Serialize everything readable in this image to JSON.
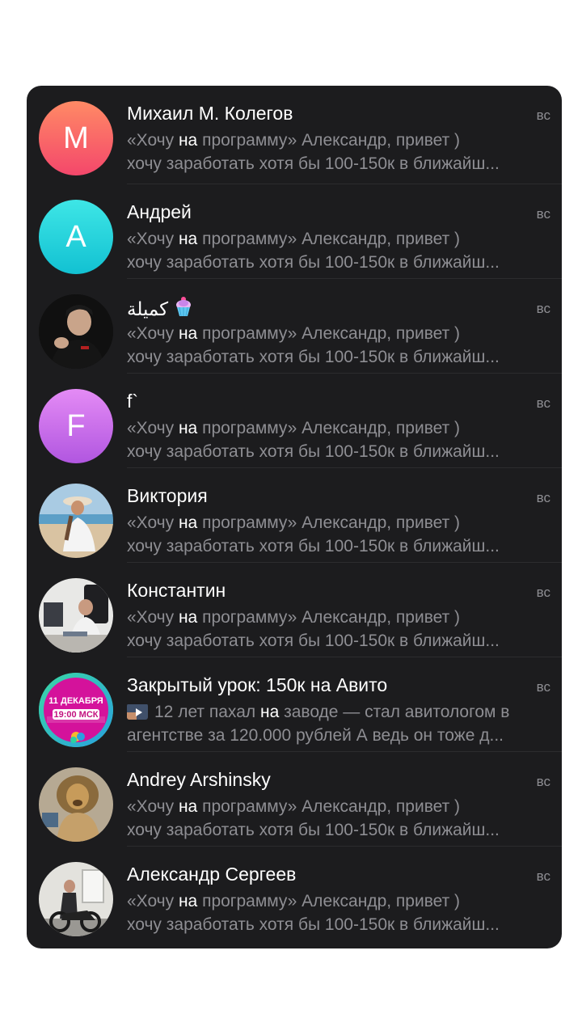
{
  "chats": [
    {
      "name": "Михаил М. Колегов",
      "time": "вс",
      "avatar_letter": "М",
      "avatar_gradient": [
        "#ff8a65",
        "#f4476b"
      ],
      "preview_a": "«Хочу ",
      "preview_hl": "на",
      "preview_b": " программу» Александр, привет )",
      "preview_line2": "хочу заработать хотя бы 100-150к в ближайш..."
    },
    {
      "name": "Андрей",
      "time": "вс",
      "avatar_letter": "А",
      "avatar_gradient": [
        "#3ee6e6",
        "#12c1d2"
      ],
      "preview_a": "«Хочу ",
      "preview_hl": "на",
      "preview_b": " программу» Александр, привет )",
      "preview_line2": "хочу заработать хотя бы 100-150к в ближайш..."
    },
    {
      "name": "كميلة",
      "time": "вс",
      "avatar_icon": "person-in-black-photo",
      "name_emoji_icon": "cupcake-icon",
      "preview_a": "«Хочу ",
      "preview_hl": "на",
      "preview_b": " программу» Александр, привет )",
      "preview_line2": "хочу заработать хотя бы 100-150к в ближайш..."
    },
    {
      "name": "f`",
      "time": "вс",
      "avatar_letter": "F",
      "avatar_gradient": [
        "#e48bf5",
        "#b156e0"
      ],
      "preview_a": "«Хочу ",
      "preview_hl": "на",
      "preview_b": " программу» Александр, привет )",
      "preview_line2": "хочу заработать хотя бы 100-150к в ближайш..."
    },
    {
      "name": "Виктория",
      "time": "вс",
      "avatar_icon": "beach-photo",
      "preview_a": "«Хочу ",
      "preview_hl": "на",
      "preview_b": " программу» Александр, привет )",
      "preview_line2": "хочу заработать хотя бы 100-150к в ближайш..."
    },
    {
      "name": "Константин",
      "time": "вс",
      "avatar_icon": "office-photo",
      "preview_a": "«Хочу ",
      "preview_hl": "на",
      "preview_b": " программу» Александр, привет )",
      "preview_line2": "хочу заработать хотя бы 100-150к в ближайш..."
    },
    {
      "name": "Закрытый урок: 150к на Авито",
      "time": "вс",
      "avatar_icon": "event-badge",
      "avatar_date": "11 ДЕКАБРЯ",
      "avatar_hour": "19:00 МСК",
      "preview_thumb_icon": "video-thumbnail-icon",
      "preview_a": "12 лет пахал ",
      "preview_hl": "на",
      "preview_b": " заводе — стал авитологом в",
      "preview_line2": "агентстве за 120.000 рублей А ведь он тоже д..."
    },
    {
      "name": "Andrey Arshinsky",
      "time": "вс",
      "avatar_icon": "lion-photo",
      "preview_a": "«Хочу ",
      "preview_hl": "на",
      "preview_b": " программу» Александр, привет )",
      "preview_line2": "хочу заработать хотя бы 100-150к в ближайш..."
    },
    {
      "name": "Александр Сергеев",
      "time": "вс",
      "avatar_icon": "motorcycle-photo",
      "preview_a": "«Хочу ",
      "preview_hl": "на",
      "preview_b": " программу» Александр, привет )",
      "preview_line2": "хочу заработать хотя бы 100-150к в ближайш..."
    }
  ]
}
